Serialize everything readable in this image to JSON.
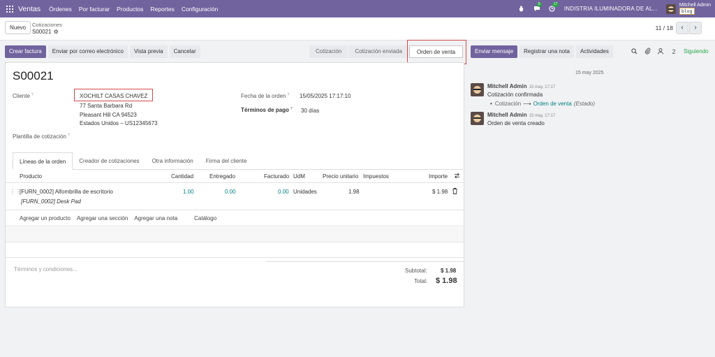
{
  "navbar": {
    "app_name": "Ventas",
    "menu": [
      "Órdenes",
      "Por facturar",
      "Productos",
      "Reportes",
      "Configuración"
    ],
    "messages_badge": "5",
    "activities_badge": "17",
    "company": "INDISTRIA ILUMINADORA DE AL...",
    "user_name": "Mitchell Admin",
    "db_name": "blog"
  },
  "control": {
    "new_label": "Nuevo",
    "breadcrumb_parent": "Cotizaciones",
    "breadcrumb_current": "S00021",
    "pager": "11 / 18"
  },
  "actions": {
    "create_invoice": "Crear factura",
    "send_email": "Enviar por correo electrónico",
    "preview": "Vista previa",
    "cancel": "Cancelar"
  },
  "status_stages": [
    "Cotización",
    "Cotización enviada",
    "Orden de venta"
  ],
  "chatter": {
    "send_message": "Enviar mensaje",
    "log_note": "Registrar una nota",
    "activities": "Actividades",
    "followers_count": "2",
    "following": "Siguiendo",
    "date": "15 may 2025",
    "messages": [
      {
        "author": "Mitchell Admin",
        "time": "15 may, 17:17",
        "text": "Cotización confirmada",
        "tracking_old": "Cotización",
        "tracking_new": "Orden de venta",
        "tracking_field": "(Estado)"
      },
      {
        "author": "Mitchell Admin",
        "time": "15 may, 17:17",
        "text": "Orden de venta creado"
      }
    ]
  },
  "form": {
    "name": "S00021",
    "customer_label": "Cliente",
    "customer_name": "XOCHILT CASAS CHAVEZ",
    "address_line1": "77 Santa Barbara Rd",
    "address_line2": "Pleasant Hill CA 94523",
    "address_line3": "Estados Unidos – US12345673",
    "template_label": "Plantilla de cotización",
    "order_date_label": "Fecha de la orden",
    "order_date": "15/05/2025 17:17:10",
    "payment_terms_label": "Términos de pago",
    "payment_terms": "30 días",
    "tabs": [
      "Líneas de la orden",
      "Creador de cotizaciones",
      "Otra información",
      "Firma del cliente"
    ],
    "columns": {
      "product": "Producto",
      "quantity": "Cantidad",
      "delivered": "Entregado",
      "invoiced": "Facturado",
      "uom": "UdM",
      "unit_price": "Precio unitario",
      "taxes": "Impuestos",
      "amount": "Importe"
    },
    "line": {
      "product": "[FURN_0002] Alfombrilla de escritorio",
      "description": "[FURN_0002] Desk Pad",
      "quantity": "1.00",
      "delivered": "0.00",
      "invoiced": "0.00",
      "uom": "Unidades",
      "unit_price": "1.98",
      "amount": "$ 1.98"
    },
    "add_product": "Agregar un producto",
    "add_section": "Agregar una sección",
    "add_note": "Agregar una nota",
    "catalog": "Catálogo",
    "terms_placeholder": "Términos y condiciones...",
    "subtotal_label": "Subtotal:",
    "subtotal": "$ 1.98",
    "total_label": "Total:",
    "total": "$ 1.98"
  }
}
